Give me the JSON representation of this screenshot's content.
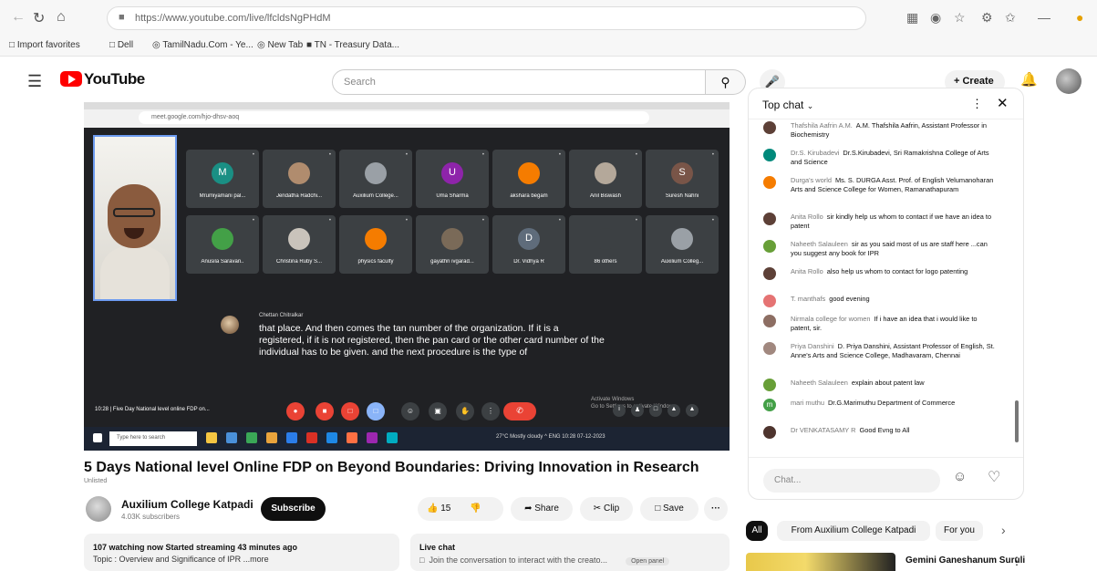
{
  "browser": {
    "url": "https://www.youtube.com/live/lfcldsNgPHdM",
    "bookmarks": [
      "Import favorites",
      "Dell",
      "TamilNadu.Com - Ye...",
      "New Tab",
      "TN - Treasury Data..."
    ]
  },
  "header": {
    "logo": "YouTube",
    "search_placeholder": "Search",
    "create_label": "Create"
  },
  "video": {
    "inner_url": "meet.google.com/hjo-dhsv-aoq",
    "speaker_name": "Chettan Chitralkar",
    "caption": "that place. And then comes the tan number of the organization. If it is a registered, if it is not registered, then the pan card or the other card number of the individual has to be given. and the next procedure is the type of",
    "meet_title": "10:28  |  Five Day National level online FDP on...",
    "windows_activate": "Activate Windows\nGo to Settings to activate Windows.",
    "taskbar_search": "Type here to search",
    "taskbar_tray": "27°C  Mostly cloudy   ^  ENG  10:28  07-12-2023",
    "participants": [
      {
        "name": "Mrumiyamani pal...",
        "initial": "M",
        "color": "#1a8f84"
      },
      {
        "name": "Jendatha Radchi...",
        "initial": "",
        "color": "#b08c6e"
      },
      {
        "name": "Auxilium College...",
        "initial": "",
        "color": "#9aa0a6"
      },
      {
        "name": "Uma Sharma",
        "initial": "U",
        "color": "#8e24aa"
      },
      {
        "name": "akshara begam",
        "initial": "",
        "color": "#f57c00"
      },
      {
        "name": "Anil Biswash",
        "initial": "",
        "color": "#b4a89a"
      },
      {
        "name": "Suresh Nahni",
        "initial": "S",
        "color": "#795548"
      },
      {
        "name": "Anusila Saravan..",
        "initial": "",
        "color": "#43a047"
      },
      {
        "name": "Christina Ruby S...",
        "initial": "",
        "color": "#c9c3bb"
      },
      {
        "name": "physics faculty",
        "initial": "",
        "color": "#f57c00"
      },
      {
        "name": "gayathri ivgarad...",
        "initial": "",
        "color": "#7a6a58"
      },
      {
        "name": "Dr. Vidhya R",
        "initial": "D",
        "color": "#5f6c7b"
      },
      {
        "name": "86 others",
        "initial": "",
        "color": "#3c4043"
      },
      {
        "name": "Auxilium Colleg...",
        "initial": "",
        "color": "#9aa0a6"
      }
    ]
  },
  "details": {
    "title": "5 Days National level Online FDP on Beyond Boundaries: Driving Innovation in Research",
    "tag": "Unlisted",
    "channel_name": "Auxilium College Katpadi",
    "subscribers": "4.03K subscribers",
    "subscribe_label": "Subscribe",
    "likes": "15",
    "share_label": "Share",
    "clip_label": "Clip",
    "save_label": "Save",
    "more_label": "···",
    "watching_line": "107 watching now  Started streaming 43 minutes ago",
    "topic_line": "Topic : Overview and Significance of IPR ...more",
    "live_chat_label": "Live chat",
    "live_chat_join": "Join the conversation to interact with the creato...",
    "open_panel": "Open panel"
  },
  "chat": {
    "mode": "Top chat",
    "input_placeholder": "Chat...",
    "messages": [
      {
        "author": "Thafshila Aafrin A.M.",
        "text": "A.M. Thafshila Aafrin, Assistant Professor in Biochemistry",
        "color": "#5d4037",
        "initial": ""
      },
      {
        "author": "Dr.S. Kirubadevi",
        "text": "Dr.S.Kirubadevi, Sri Ramakrishna College of Arts and Science",
        "color": "#00897b",
        "initial": ""
      },
      {
        "author": "Durga's world",
        "text": "Ms. S. DURGA Asst. Prof. of English Velumanoharan Arts and Science College for Women, Ramanathapuram",
        "color": "#f57c00",
        "initial": ""
      },
      {
        "author": "Anita Rollo",
        "text": "sir kindly help us whom to contact if we have an idea to patent",
        "color": "#5d4037",
        "initial": ""
      },
      {
        "author": "Naheeth Salauleen",
        "text": "sir as you said most of us are staff here ...can you suggest any book for IPR",
        "color": "#689f38",
        "initial": ""
      },
      {
        "author": "Anita Rollo",
        "text": "also help us whom to contact for logo patenting",
        "color": "#5d4037",
        "initial": ""
      },
      {
        "author": "T. manthafs",
        "text": "good evening",
        "color": "#e57373",
        "initial": ""
      },
      {
        "author": "Nirmala college for women",
        "text": "If i have an idea that i would like to patent, sir.",
        "color": "#8d6e63",
        "initial": ""
      },
      {
        "author": "Priya Danshini",
        "text": "D. Priya Danshini, Assistant Professor of English, St. Anne's Arts and Science College, Madhavaram, Chennai",
        "color": "#a1887f",
        "initial": ""
      },
      {
        "author": "Naheeth Salauleen",
        "text": "explain about patent law",
        "color": "#689f38",
        "initial": ""
      },
      {
        "author": "mari muthu",
        "text": "Dr.G.Marimuthu Department of Commerce",
        "color": "#43a047",
        "initial": "m"
      },
      {
        "author": "Dr VENKATASAMY R",
        "text": "Good Evng to All",
        "color": "#4e342e",
        "initial": ""
      }
    ]
  },
  "chips": [
    "All",
    "From Auxilium College Katpadi",
    "For you"
  ],
  "recommendation": {
    "title": "Gemini Ganeshanum Suruli"
  }
}
